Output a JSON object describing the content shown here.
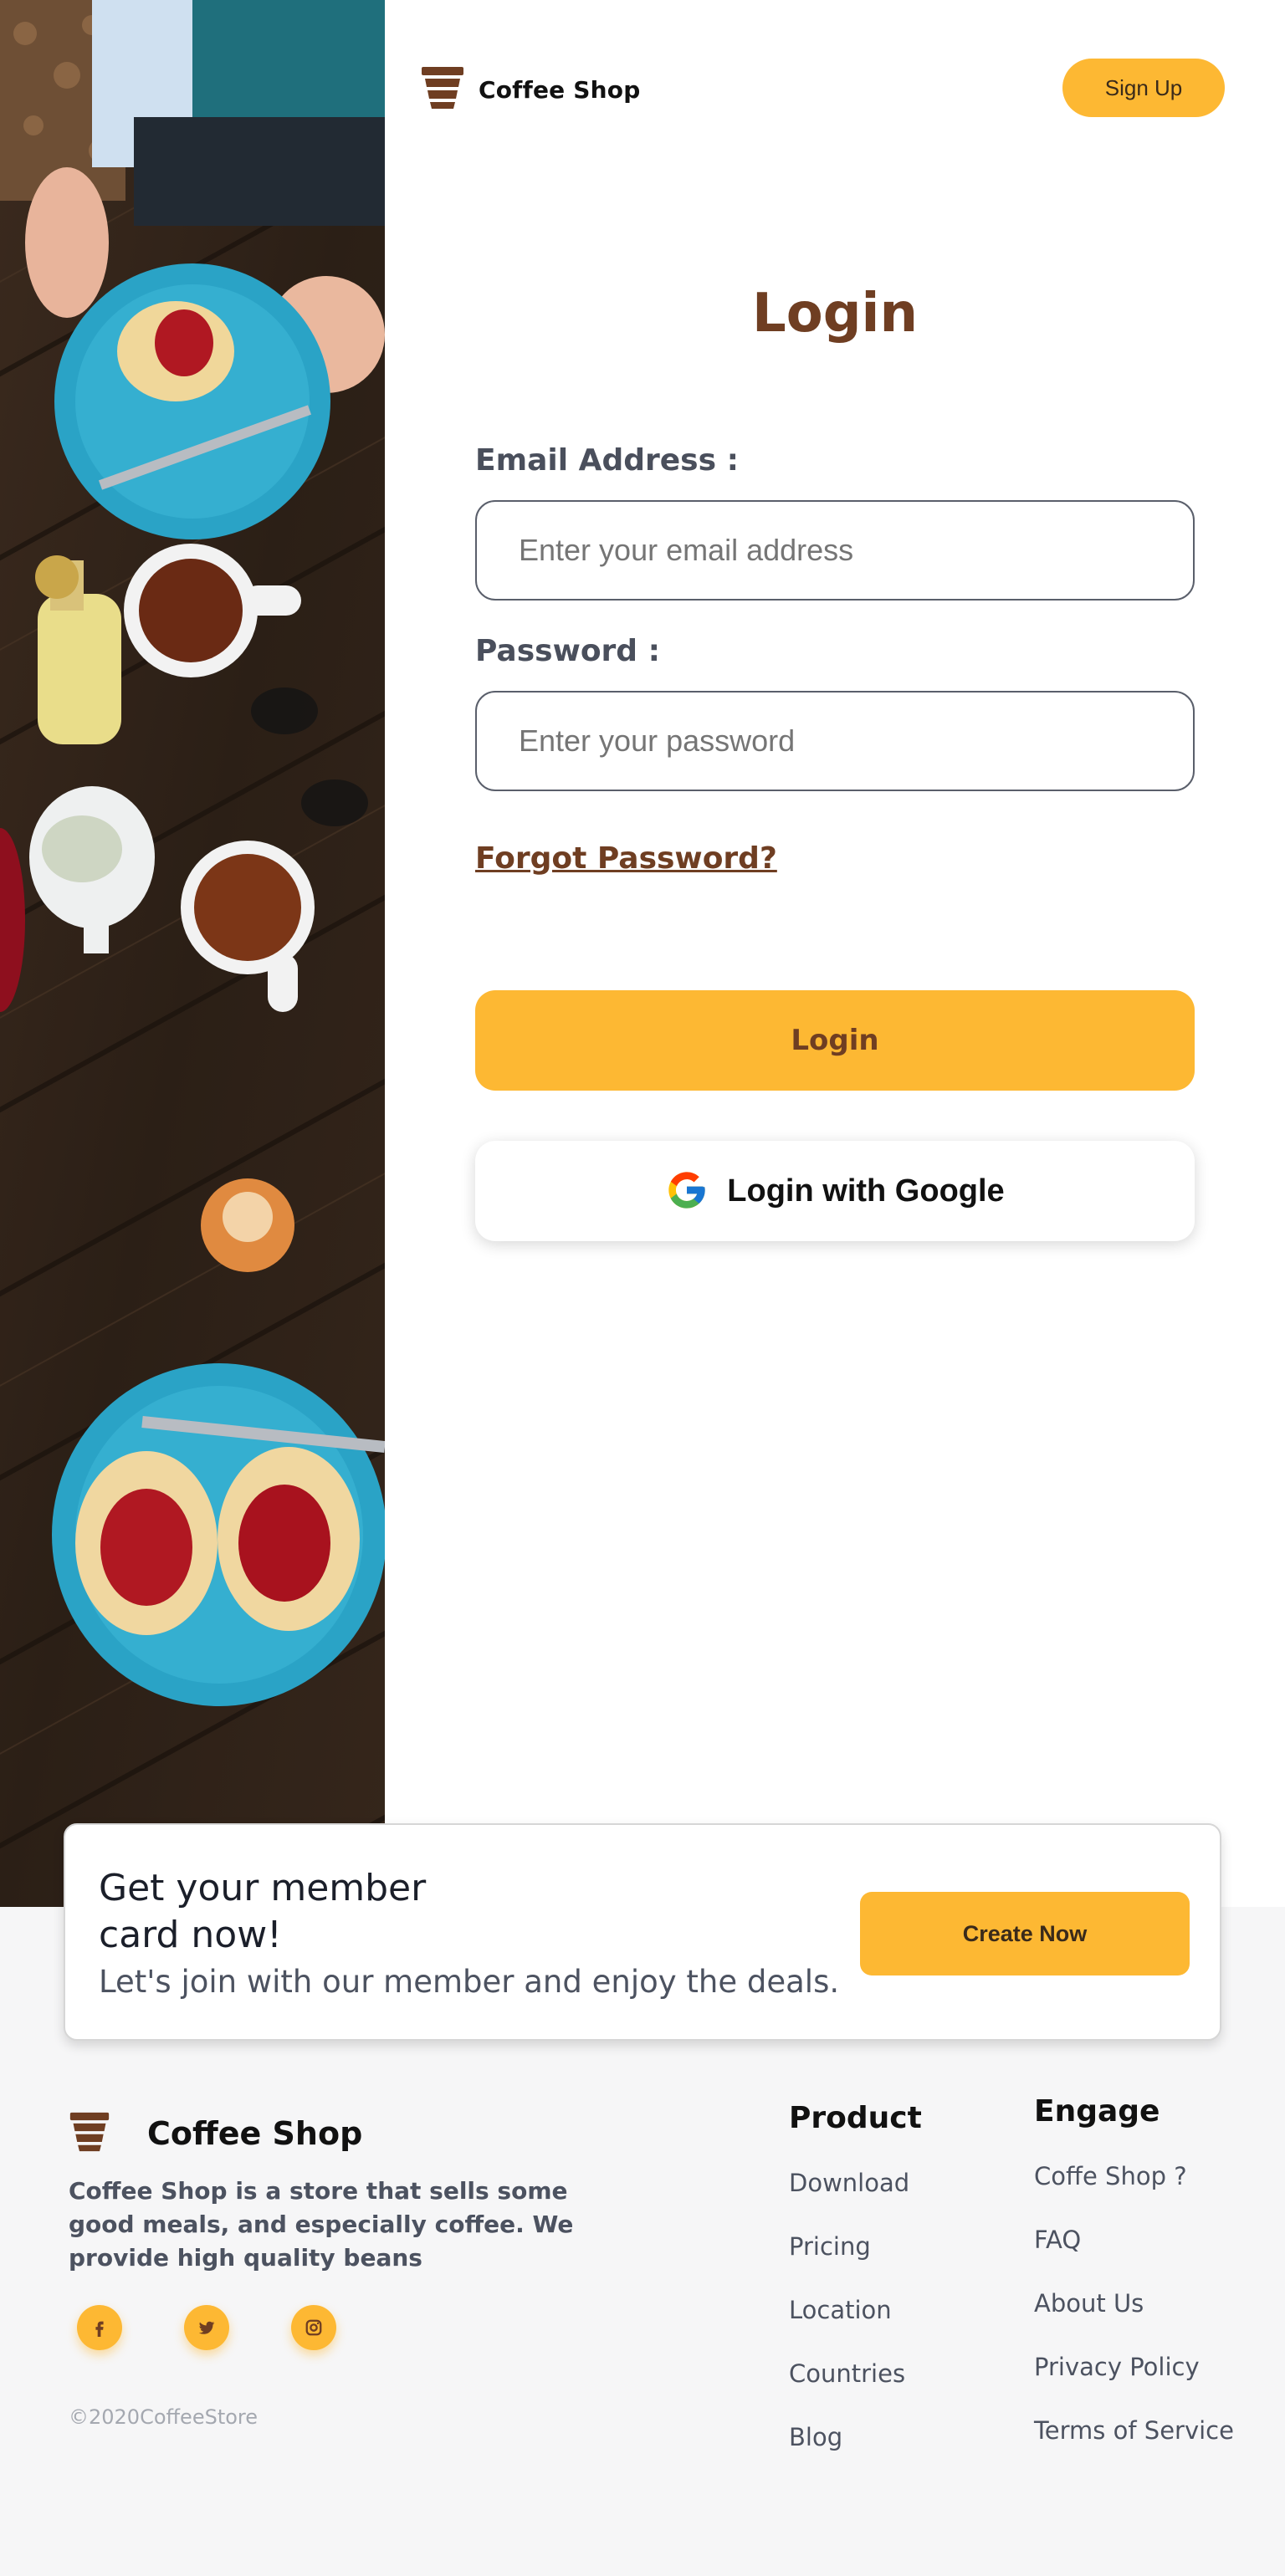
{
  "header": {
    "brand_name": "Coffee Shop",
    "signup_label": "Sign Up"
  },
  "login": {
    "title": "Login",
    "email_label": "Email Address :",
    "email_placeholder": "Enter your email address",
    "password_label": "Password :",
    "password_placeholder": "Enter your password",
    "forgot_label": "Forgot Password?",
    "login_button": "Login",
    "google_button": "Login with Google"
  },
  "member_card": {
    "title": "Get your member card now!",
    "subtitle": "Let's join with our member and enjoy the deals.",
    "button": "Create Now"
  },
  "footer": {
    "brand_name": "Coffee Shop",
    "description": "Coffee Shop is a store that sells some good meals, and especially coffee. We provide high quality beans",
    "socials": [
      "facebook-icon",
      "twitter-icon",
      "instagram-icon"
    ],
    "copyright": "©2020CoffeeStore",
    "product": {
      "title": "Product",
      "items": [
        "Download",
        "Pricing",
        "Location",
        "Countries",
        "Blog"
      ]
    },
    "engage": {
      "title": "Engage",
      "items": [
        "Coffe Shop ?",
        "FAQ",
        "About Us",
        "Privacy Policy",
        "Terms of Service"
      ]
    }
  },
  "colors": {
    "accent": "#FDB833",
    "brand_brown": "#6F3E22",
    "footer_bg": "#F6F6F7",
    "text_gray": "#4C5260"
  }
}
